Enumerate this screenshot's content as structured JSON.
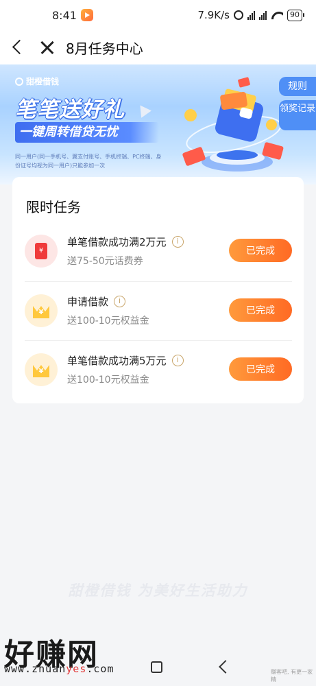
{
  "status_bar": {
    "time": "8:41",
    "net_speed": "7.9K/s",
    "battery": "90"
  },
  "nav": {
    "title": "8月任务中心"
  },
  "banner": {
    "brand": "甜橙借钱",
    "headline": "笔笔送好礼",
    "subhead": "一键周转借贷无忧",
    "disclaimer": "同一用户(同一手机号、翼支付账号、手机终端、PC终端、身份证号均视为同一用户)只能参加一次",
    "rules_tab": "规则",
    "record_tab": "领奖记录"
  },
  "tasks": {
    "title": "限时任务",
    "items": [
      {
        "name": "单笔借款成功满2万元",
        "reward": "送75-50元话费券",
        "button": "已完成",
        "icon": "red-envelope-icon"
      },
      {
        "name": "申请借款",
        "reward": "送100-10元权益金",
        "button": "已完成",
        "icon": "crown-icon"
      },
      {
        "name": "单笔借款成功满5万元",
        "reward": "送100-10元权益金",
        "button": "已完成",
        "icon": "crown-icon"
      }
    ]
  },
  "footer": {
    "slogan": "甜橙借钱  为美好生活助力"
  },
  "watermark": {
    "big": "好赚网",
    "url_a": "www.zhuan",
    "url_b": "yes",
    "url_c": ".com",
    "tiny": "赚客吧, 有更一家精"
  },
  "colors": {
    "accent_orange": "#ff7a2e",
    "banner_blue": "#4f8ff6"
  }
}
